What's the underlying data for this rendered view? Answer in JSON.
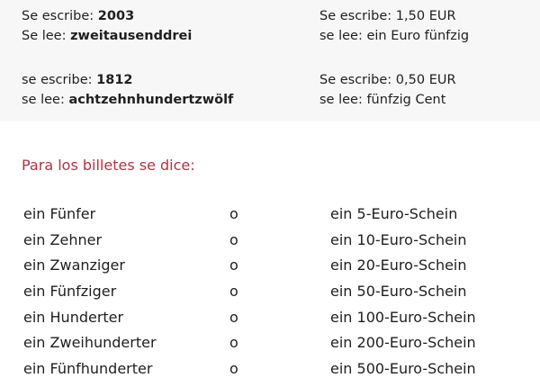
{
  "examples": [
    {
      "line1_label": "Se escribe: ",
      "line1_value": "2003",
      "line2_label": "Se lee: ",
      "line2_value": "zweitausenddrei"
    },
    {
      "line1_label": "se escribe: ",
      "line1_value": "1812",
      "line2_label": "se lee: ",
      "line2_value": "achtzehnhundertzwölf"
    },
    {
      "line1_label": "Se escribe: ",
      "line1_value": "1,50 EUR",
      "line2_label": "se lee: ",
      "line2_value": "ein Euro fünfzig"
    },
    {
      "line1_label": "Se escribe: ",
      "line1_value": "0,50 EUR",
      "line2_label": "se lee: ",
      "line2_value": "fünfzig Cent"
    }
  ],
  "section_heading": "Para los billetes se dice:",
  "bills": [
    {
      "colloquial": "ein Fünfer",
      "conj": "o",
      "formal": "ein 5-Euro-Schein"
    },
    {
      "colloquial": "ein Zehner",
      "conj": "o",
      "formal": "ein 10-Euro-Schein"
    },
    {
      "colloquial": "ein Zwanziger",
      "conj": "o",
      "formal": "ein 20-Euro-Schein"
    },
    {
      "colloquial": "ein Fünfziger",
      "conj": "o",
      "formal": "ein 50-Euro-Schein"
    },
    {
      "colloquial": "ein Hunderter",
      "conj": "o",
      "formal": "ein 100-Euro-Schein"
    },
    {
      "colloquial": "ein Zweihunderter",
      "conj": "o",
      "formal": "ein 200-Euro-Schein"
    },
    {
      "colloquial": "ein Fünfhunderter",
      "conj": "o",
      "formal": "ein 500-Euro-Schein"
    }
  ],
  "colors": {
    "heading": "#b5323f",
    "band": "#f7f7f7",
    "text": "#1f1f1f"
  }
}
